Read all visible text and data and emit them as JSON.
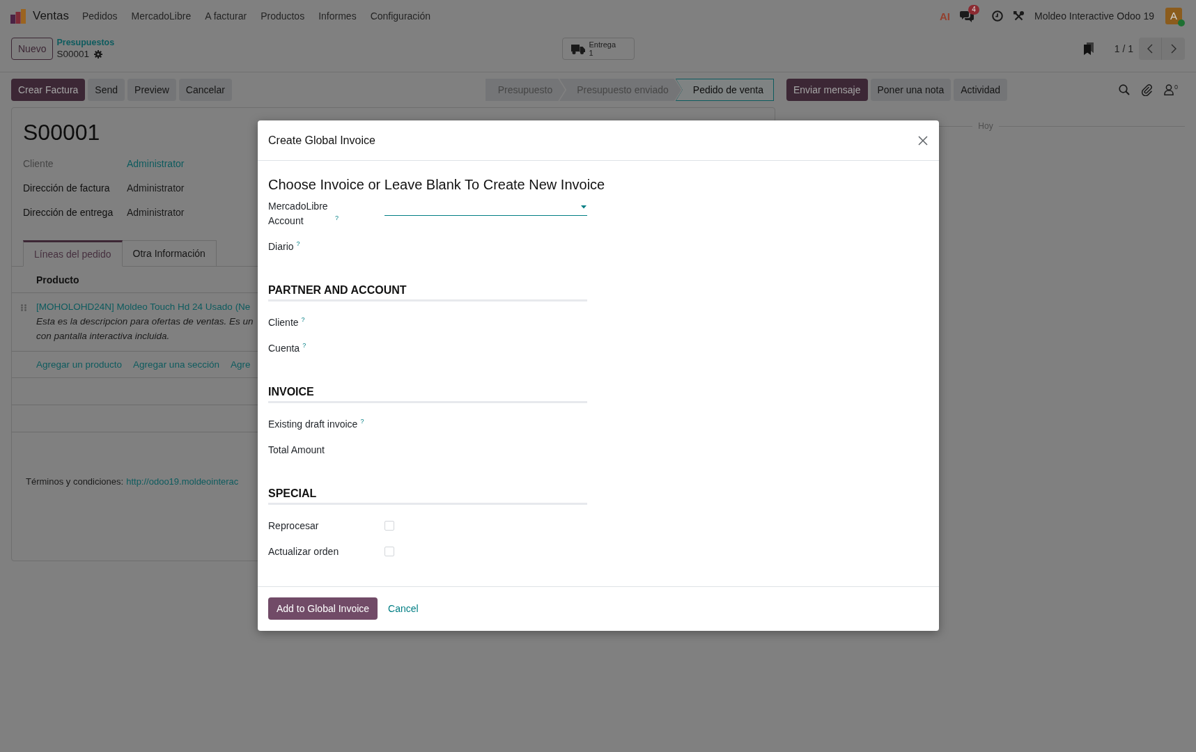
{
  "navbar": {
    "app": "Ventas",
    "menu": [
      "Pedidos",
      "MercadoLibre",
      "A facturar",
      "Productos",
      "Informes",
      "Configuración"
    ],
    "ai": "AI",
    "messages_badge": "4",
    "company": "Moldeo Interactive Odoo 19",
    "user": {
      "initial": "A",
      "online": true
    }
  },
  "control_panel": {
    "new_button": "Nuevo",
    "breadcrumb": "Presupuestos",
    "record": "S00001",
    "smart_button": {
      "label": "Entrega",
      "count": "1"
    },
    "pager": "1 / 1"
  },
  "actions": [
    {
      "label": "Crear Factura",
      "kind": "primary"
    },
    {
      "label": "Send",
      "kind": "secondary"
    },
    {
      "label": "Preview",
      "kind": "secondary"
    },
    {
      "label": "Cancelar",
      "kind": "secondary"
    }
  ],
  "statusbar": [
    {
      "label": "Presupuesto",
      "selected": false
    },
    {
      "label": "Presupuesto enviado",
      "selected": false
    },
    {
      "label": "Pedido de venta",
      "selected": true
    }
  ],
  "form": {
    "title": "S00001",
    "fields": [
      {
        "label": "Cliente",
        "value": "Administrator",
        "kind": "link"
      },
      {
        "label": "Dirección de factura",
        "value": "Administrator",
        "kind": "text"
      },
      {
        "label": "Dirección de entrega",
        "value": "Administrator",
        "kind": "text"
      }
    ],
    "tabs": [
      {
        "label": "Líneas del pedido",
        "selected": true
      },
      {
        "label": "Otra Información",
        "selected": false
      }
    ],
    "table": {
      "columns": [
        "Producto"
      ],
      "rows": [
        {
          "product": "[MOHOLOHD24N] Moldeo Touch Hd 24 Usado (Ne",
          "description": [
            "Esta es la descripcion para ofertas de ventas. Es un",
            "con pantalla interactiva incluida."
          ]
        }
      ],
      "add_links": [
        "Agregar un producto",
        "Agregar una sección",
        "Agre"
      ]
    },
    "terms": {
      "label": "Términos y condiciones:",
      "link": "http://odoo19.moldeointerac"
    }
  },
  "chatter": {
    "buttons": [
      {
        "label": "Enviar mensaje",
        "kind": "primary"
      },
      {
        "label": "Poner una nota",
        "kind": "secondary"
      },
      {
        "label": "Actividad",
        "kind": "secondary"
      }
    ],
    "followers": "0",
    "date_separator": "Hoy"
  },
  "dialog": {
    "title": "Create Global Invoice",
    "heading": "Choose Invoice or Leave Blank To Create New Invoice",
    "sections": [
      {
        "fields": [
          {
            "label": "MercadoLibre Account",
            "help": "?",
            "kind": "select"
          },
          {
            "label": "Diario",
            "help": "?",
            "kind": "empty"
          }
        ]
      },
      {
        "title": "PARTNER AND ACCOUNT",
        "fields": [
          {
            "label": "Cliente",
            "help": "?",
            "kind": "empty"
          },
          {
            "label": "Cuenta",
            "help": "?",
            "kind": "empty"
          }
        ]
      },
      {
        "title": "INVOICE",
        "fields": [
          {
            "label": "Existing draft invoice",
            "help": "?",
            "kind": "empty"
          },
          {
            "label": "Total Amount",
            "kind": "empty"
          }
        ]
      },
      {
        "title": "SPECIAL",
        "fields": [
          {
            "label": "Reprocesar",
            "kind": "checkbox",
            "checked": false
          },
          {
            "label": "Actualizar orden",
            "kind": "checkbox",
            "checked": false
          }
        ]
      }
    ],
    "buttons": [
      {
        "label": "Add to Global Invoice",
        "kind": "primary"
      },
      {
        "label": "Cancel",
        "kind": "link"
      }
    ]
  }
}
